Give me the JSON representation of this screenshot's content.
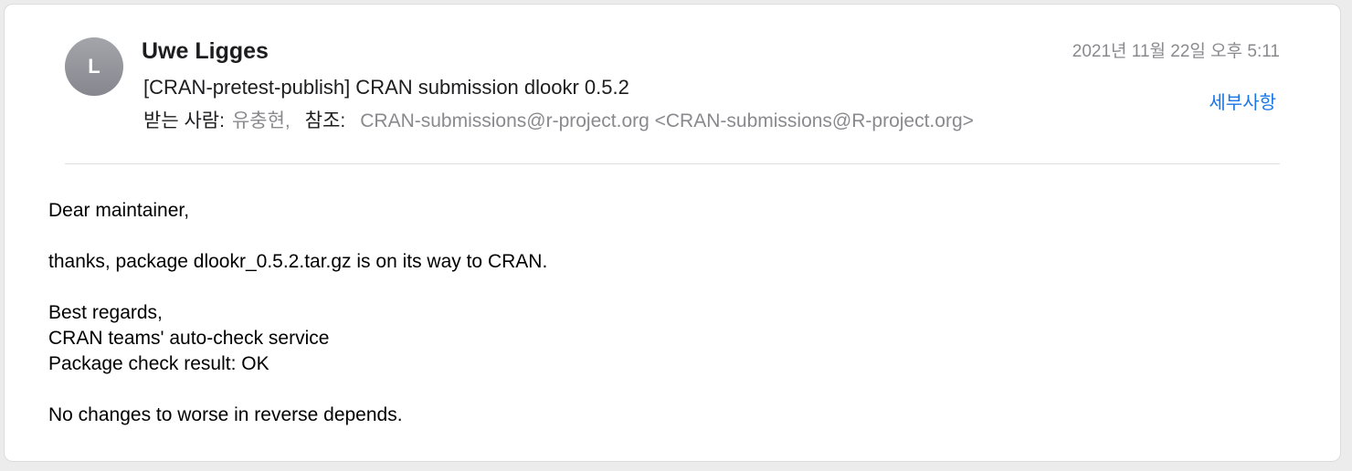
{
  "message": {
    "avatar_initial": "L",
    "sender_name": "Uwe Ligges",
    "date": "2021년 11월 22일 오후 5:11",
    "subject": "[CRAN-pretest-publish] CRAN submission dlookr 0.5.2",
    "details_label": "세부사항",
    "to_label": "받는 사람:",
    "to_value": "유충현,",
    "cc_label": "참조:",
    "cc_value": "CRAN-submissions@r-project.org <CRAN-submissions@R-project.org>",
    "body": {
      "line1": "Dear maintainer,",
      "line2": "thanks, package dlookr_0.5.2.tar.gz is on its way to CRAN.",
      "line3": "Best regards,",
      "line4": "CRAN teams' auto-check service",
      "line5": "Package check result: OK",
      "line6": "No changes to worse in reverse depends."
    }
  },
  "colors": {
    "accent_link": "#1877e6",
    "secondary_text": "#8a8a8e",
    "avatar_bg": "#95969c"
  }
}
